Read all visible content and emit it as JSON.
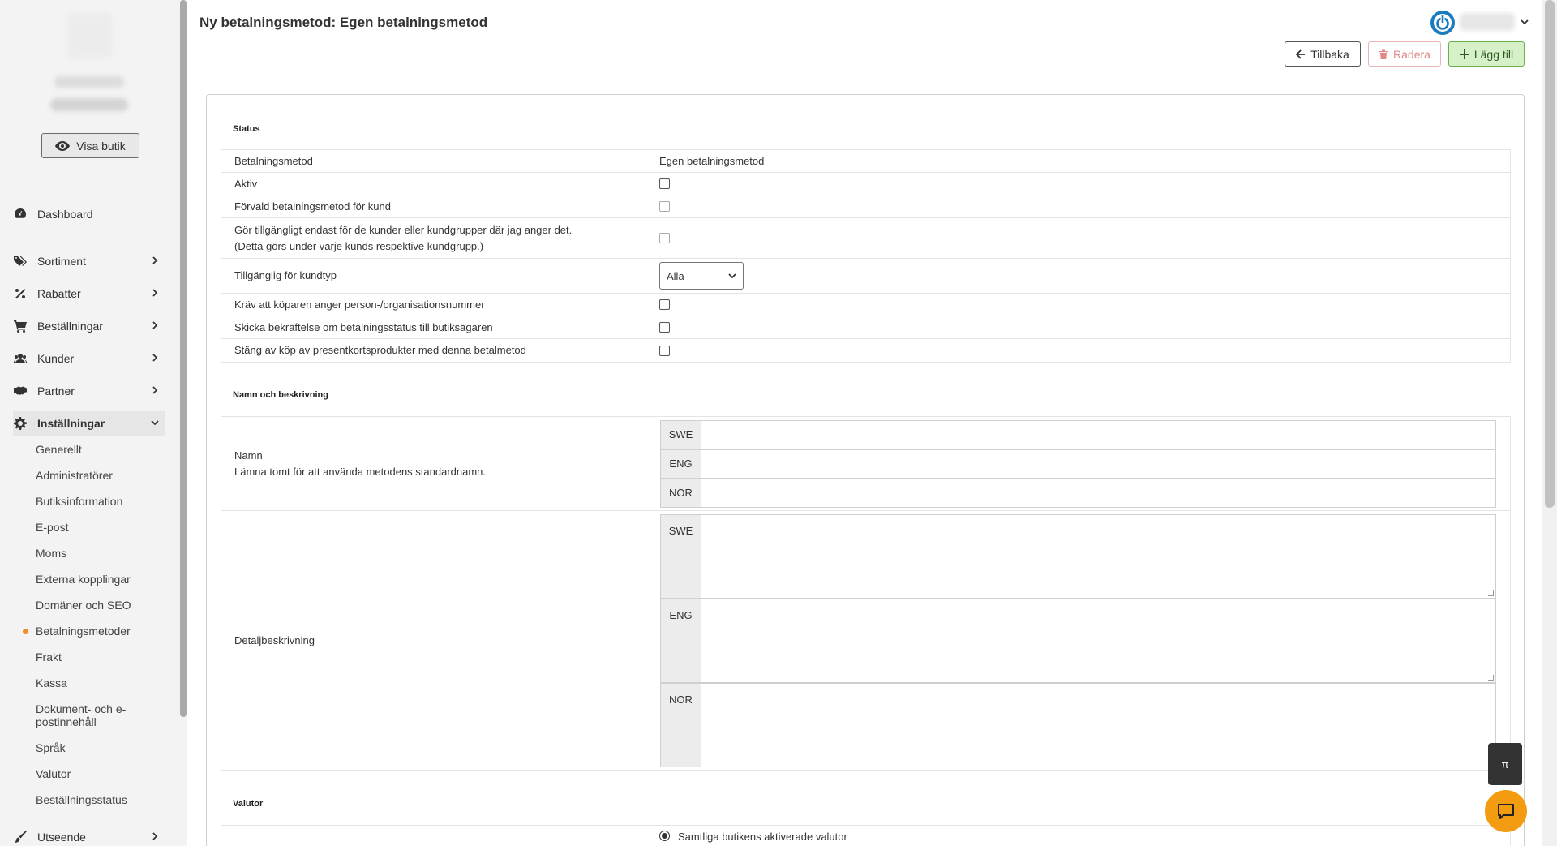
{
  "sidebar": {
    "visa_butik": "Visa butik",
    "nav": [
      {
        "label": "Dashboard",
        "icon": "dashboard-icon"
      },
      {
        "label": "Sortiment",
        "icon": "tags-icon"
      },
      {
        "label": "Rabatter",
        "icon": "percent-icon"
      },
      {
        "label": "Beställningar",
        "icon": "cart-icon"
      },
      {
        "label": "Kunder",
        "icon": "users-icon"
      },
      {
        "label": "Partner",
        "icon": "handshake-icon"
      },
      {
        "label": "Inställningar",
        "icon": "gear-icon"
      },
      {
        "label": "Utseende",
        "icon": "brush-icon"
      }
    ],
    "sub_items": [
      "Generellt",
      "Administratörer",
      "Butiksinformation",
      "E-post",
      "Moms",
      "Externa kopplingar",
      "Domäner och SEO",
      "Betalningsmetoder",
      "Frakt",
      "Kassa",
      "Dokument- och e-postinnehåll",
      "Språk",
      "Valutor",
      "Beställningsstatus"
    ]
  },
  "header": {
    "title": "Ny betalningsmetod: Egen betalningsmetod",
    "back_label": "Tillbaka",
    "delete_label": "Radera",
    "add_label": "Lägg till"
  },
  "status": {
    "title": "Status",
    "rows": [
      {
        "label": "Betalningsmetod",
        "value": "Egen betalningsmetod"
      },
      {
        "label": "Aktiv"
      },
      {
        "label": "Förvald betalningsmetod för kund"
      },
      {
        "label": "Gör tillgängligt endast för de kunder eller kundgrupper där jag anger det.",
        "label2": "(Detta görs under varje kunds respektive kundgrupp.)"
      },
      {
        "label": "Tillgänglig för kundtyp",
        "select": "Alla"
      },
      {
        "label": "Kräv att köparen anger person-/organisationsnummer"
      },
      {
        "label": "Skicka bekräftelse om betalningsstatus till butiksägaren"
      },
      {
        "label": "Stäng av köp av presentkortsprodukter med denna betalmetod"
      }
    ]
  },
  "name_section": {
    "title": "Namn och beskrivning",
    "name_label": "Namn",
    "name_hint": "Lämna tomt för att använda metodens standardnamn.",
    "detail_label": "Detaljbeskrivning",
    "langs": [
      "SWE",
      "ENG",
      "NOR"
    ]
  },
  "currency_section": {
    "title": "Valutor",
    "option": "Samtliga butikens aktiverade valutor"
  },
  "floating": {
    "top_label": "π"
  },
  "colors": {
    "accent_orange": "#f28c28",
    "power_blue": "#1a7bbf",
    "add_green": "#d6f0c8"
  }
}
